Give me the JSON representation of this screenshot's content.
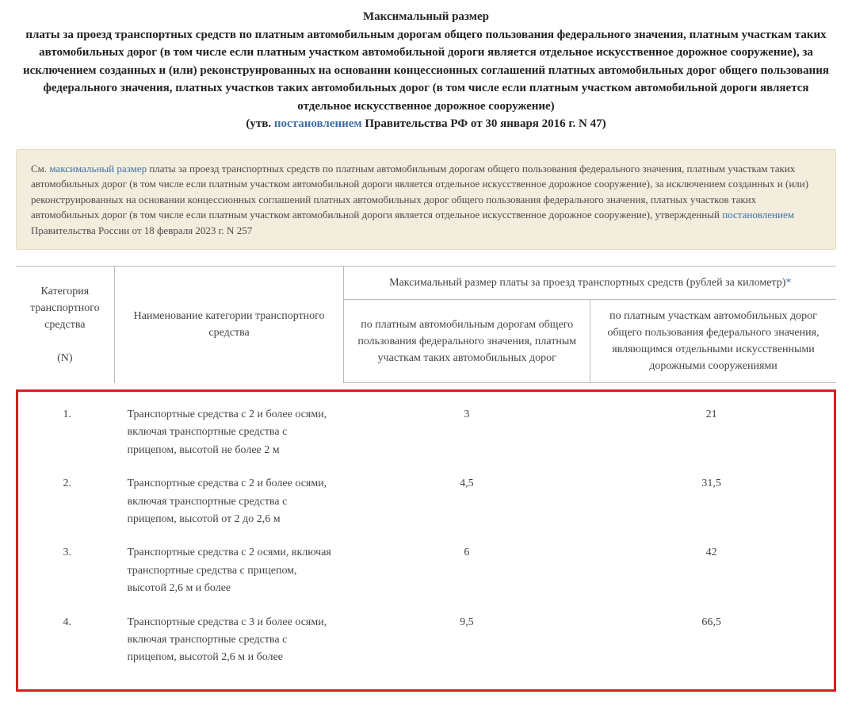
{
  "title": {
    "line1": "Максимальный размер",
    "line2": "платы за проезд транспортных средств по платным автомобильным дорогам общего пользования федерального значения, платным участкам таких автомобильных дорог (в том числе если платным участком автомобильной дороги является отдельное искусственное дорожное сооружение), за исключением созданных и (или) реконструированных на основании концессионных соглашений платных автомобильных дорог общего пользования федерального значения, платных участков таких автомобильных дорог (в том числе если платным участком автомобильной дороги является отдельное искусственное дорожное сооружение)",
    "line3_prefix": "(утв. ",
    "line3_link": "постановлением",
    "line3_suffix": " Правительства РФ от 30 января 2016 г. N 47)"
  },
  "note": {
    "prefix": "См. ",
    "link1": "максимальный размер",
    "mid": " платы за проезд транспортных средств по платным автомобильным дорогам общего пользования федерального значения, платным участкам таких автомобильных дорог (в том числе если платным участком автомобильной дороги является отдельное искусственное дорожное сооружение), за исключением созданных и (или) реконструированных на основании концессионных соглашений платных автомобильных дорог общего пользования федерального значения, платных участков таких автомобильных дорог (в том числе если платным участком автомобильной дороги является отдельное искусственное дорожное сооружение), утвержденный ",
    "link2": "постановлением",
    "suffix": " Правительства России от 18 февраля 2023 г. N 257"
  },
  "table": {
    "headers": {
      "col_n": "Категория транспортного средства",
      "col_n_sub": "(N)",
      "col_name": "Наименование категории транспортного средства",
      "col_max": "Максимальный размер платы за проезд транспортных средств (рублей за километр)",
      "star": "*",
      "sub1": "по платным автомобильным дорогам общего пользования федерального значения, платным участкам таких автомобильных дорог",
      "sub2": "по платным участкам автомобильных дорог общего пользования федерального значения, являющимся отдельными искусственными дорожными сооружениями"
    },
    "rows": [
      {
        "n": "1.",
        "name": "Транспортные средства с 2 и более осями, включая транспортные средства с прицепом, высотой не более 2 м",
        "v1": "3",
        "v2": "21"
      },
      {
        "n": "2.",
        "name": "Транспортные средства с 2 и более осями, включая транспортные средства с прицепом, высотой от 2 до 2,6 м",
        "v1": "4,5",
        "v2": "31,5"
      },
      {
        "n": "3.",
        "name": "Транспортные средства с 2 осями, включая транспортные средства с прицепом, высотой 2,6 м и более",
        "v1": "6",
        "v2": "42"
      },
      {
        "n": "4.",
        "name": "Транспортные средства с 3 и более осями, включая транспортные средства с прицепом, высотой 2,6 м и более",
        "v1": "9,5",
        "v2": "66,5"
      }
    ]
  }
}
